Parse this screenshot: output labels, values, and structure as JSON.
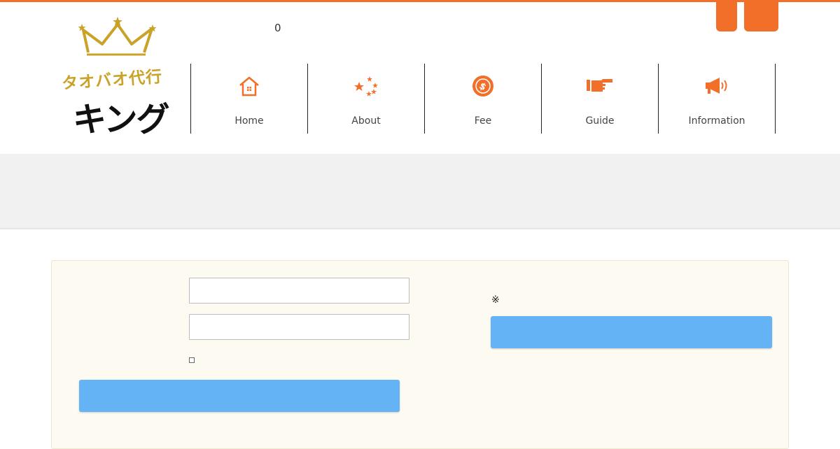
{
  "brand": {
    "kana": "タオバオ代行",
    "name": "キング",
    "crown_color": "#c9a227"
  },
  "header": {
    "cart_count": "0",
    "accent_color": "#f26f2a"
  },
  "nav": {
    "items": [
      {
        "label": "Home",
        "icon": "house-icon"
      },
      {
        "label": "About",
        "icon": "stars-icon"
      },
      {
        "label": "Fee",
        "icon": "coin-icon"
      },
      {
        "label": "Guide",
        "icon": "pointing-hand-icon"
      },
      {
        "label": "Information",
        "icon": "megaphone-icon"
      }
    ]
  },
  "login": {
    "username_value": "",
    "password_value": "",
    "button_label": "",
    "button_color": "#64b3f4"
  },
  "register": {
    "note": "※",
    "button_label": ""
  }
}
